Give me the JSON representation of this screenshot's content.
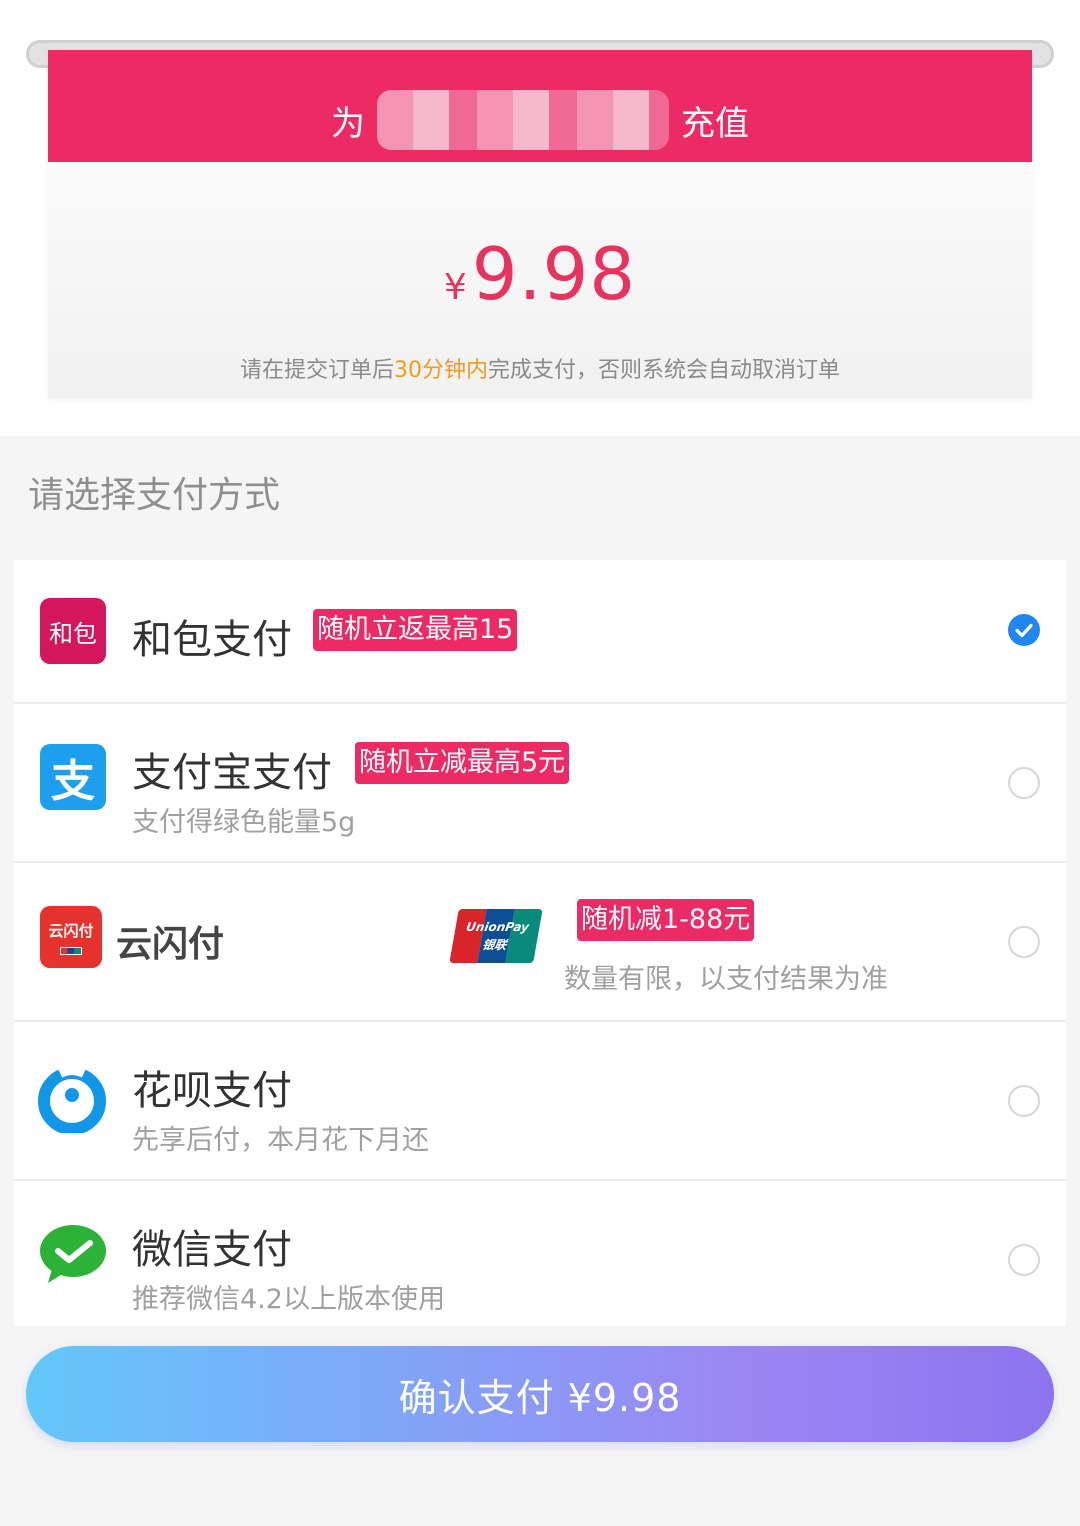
{
  "header": {
    "prefix": "为",
    "suffix": "充值",
    "currency": "¥",
    "amount": "9.98",
    "notice_before": "请在提交订单后",
    "notice_highlight": "30分钟内",
    "notice_after": "完成支付，否则系统会自动取消订单"
  },
  "section_title": "请选择支付方式",
  "methods": [
    {
      "name": "和包支付",
      "badge": "随机立返最高15",
      "sub": "",
      "logo_text": "和包",
      "selected": true
    },
    {
      "name": "支付宝支付",
      "badge": "随机立减最高5元",
      "sub": "支付得绿色能量5g",
      "logo_text": "支",
      "selected": false
    },
    {
      "name": "云闪付",
      "badge": "随机减1-88元",
      "sub": "数量有限，以支付结果为准",
      "logo_text": "云闪付",
      "unionpay_text": "UnionPay 银联",
      "selected": false
    },
    {
      "name": "花呗支付",
      "badge": "",
      "sub": "先享后付，本月花下月还",
      "selected": false
    },
    {
      "name": "微信支付",
      "badge": "",
      "sub": "推荐微信4.2以上版本使用",
      "selected": false
    }
  ],
  "confirm_label": "确认支付 ¥9.98",
  "colors": {
    "brand_pink": "#ec2a64",
    "highlight_orange": "#f29a1c",
    "check_blue": "#1e88f0",
    "alipay_blue": "#1e9fee",
    "huabei_blue": "#1296e8",
    "wechat_green": "#2bb237",
    "button_gradient_start": "#63c7fb",
    "button_gradient_end": "#8c74ef"
  }
}
